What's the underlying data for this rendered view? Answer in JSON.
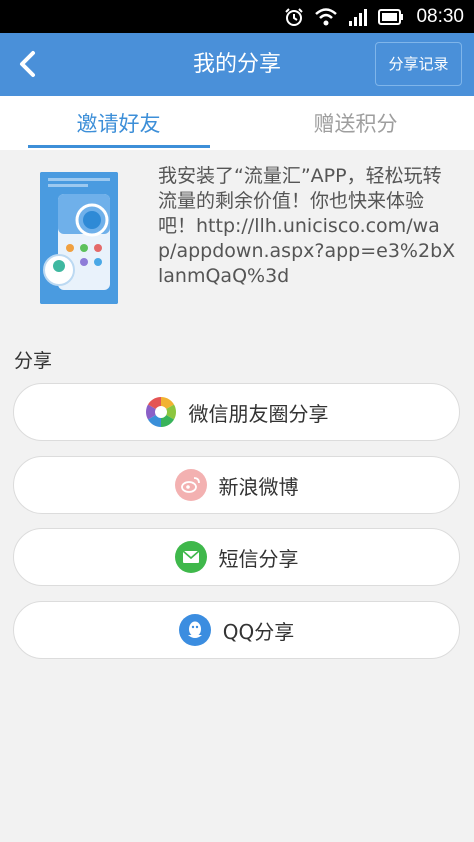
{
  "status_bar": {
    "time": "08:30"
  },
  "header": {
    "title": "我的分享",
    "history_label": "分享记录"
  },
  "tabs": [
    {
      "label": "邀请好友",
      "active": true
    },
    {
      "label": "赠送积分",
      "active": false
    }
  ],
  "share_content": {
    "message": "我安装了“流量汇”APP，轻松玩转流量的剩余价值！你也快来体验吧！http://llh.unicisco.com/wap/appdown.aspx?app=e3%2bXlanmQaQ%3d"
  },
  "share_section": {
    "label": "分享",
    "buttons": [
      {
        "label": "微信朋友圈分享",
        "icon": "wechat-moments-icon"
      },
      {
        "label": "新浪微博",
        "icon": "weibo-icon"
      },
      {
        "label": "短信分享",
        "icon": "sms-icon"
      },
      {
        "label": "QQ分享",
        "icon": "qq-icon"
      }
    ]
  },
  "colors": {
    "accent": "#4a90d9",
    "tab_active": "#3d8fd8",
    "tab_inactive": "#9e9e9e",
    "sms_green": "#3fb84b",
    "qq_blue": "#3b8de0",
    "weibo_pink": "#f3b1b1"
  }
}
